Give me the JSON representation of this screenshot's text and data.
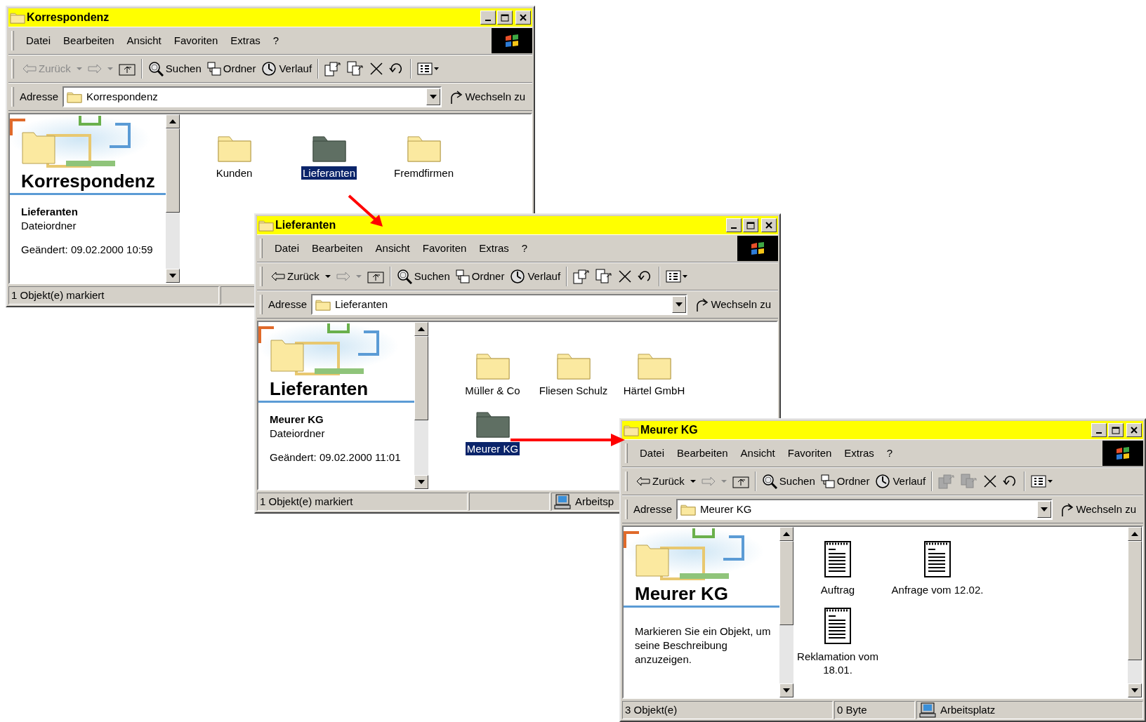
{
  "windows": [
    {
      "title": "Korrespondenz",
      "menu": [
        "Datei",
        "Bearbeiten",
        "Ansicht",
        "Favoriten",
        "Extras",
        "?"
      ],
      "toolbar": {
        "back": {
          "label": "Zurück",
          "disabled": true
        },
        "forward_disabled": true,
        "search": "Suchen",
        "folders": "Ordner",
        "history": "Verlauf",
        "move_copy_disabled": false
      },
      "address": {
        "label": "Adresse",
        "value": "Korrespondenz",
        "go": "Wechseln zu"
      },
      "sidebar": {
        "heading": "Korrespondenz",
        "selection": {
          "name": "Lieferanten",
          "type": "Dateiordner",
          "modified": "Geändert: 09.02.2000 10:59"
        }
      },
      "items": [
        {
          "label": "Kunden",
          "kind": "folder",
          "selected": false
        },
        {
          "label": "Lieferanten",
          "kind": "folder",
          "selected": true
        },
        {
          "label": "Fremdfirmen",
          "kind": "folder",
          "selected": false
        }
      ],
      "status": [
        {
          "kind": "text",
          "text": "1 Objekt(e) markiert"
        },
        {
          "kind": "blank"
        }
      ]
    },
    {
      "title": "Lieferanten",
      "menu": [
        "Datei",
        "Bearbeiten",
        "Ansicht",
        "Favoriten",
        "Extras",
        "?"
      ],
      "toolbar": {
        "back": {
          "label": "Zurück",
          "disabled": false
        },
        "forward_disabled": true,
        "search": "Suchen",
        "folders": "Ordner",
        "history": "Verlauf",
        "move_copy_disabled": false
      },
      "address": {
        "label": "Adresse",
        "value": "Lieferanten",
        "go": "Wechseln zu"
      },
      "sidebar": {
        "heading": "Lieferanten",
        "selection": {
          "name": "Meurer KG",
          "type": "Dateiordner",
          "modified": "Geändert: 09.02.2000 11:01"
        }
      },
      "items": [
        {
          "label": "Müller & Co",
          "kind": "folder",
          "selected": false
        },
        {
          "label": "Fliesen Schulz",
          "kind": "folder",
          "selected": false
        },
        {
          "label": "Härtel GmbH",
          "kind": "folder",
          "selected": false
        },
        {
          "label": "Meurer KG",
          "kind": "folder",
          "selected": true
        }
      ],
      "status": [
        {
          "kind": "text",
          "text": "1 Objekt(e) markiert"
        },
        {
          "kind": "blank"
        },
        {
          "kind": "zone",
          "text": "Arbeitsp"
        }
      ]
    },
    {
      "title": "Meurer KG",
      "menu": [
        "Datei",
        "Bearbeiten",
        "Ansicht",
        "Favoriten",
        "Extras",
        "?"
      ],
      "toolbar": {
        "back": {
          "label": "Zurück",
          "disabled": false
        },
        "forward_disabled": true,
        "search": "Suchen",
        "folders": "Ordner",
        "history": "Verlauf",
        "move_copy_disabled": true
      },
      "address": {
        "label": "Adresse",
        "value": "Meurer KG",
        "go": "Wechseln zu"
      },
      "sidebar": {
        "heading": "Meurer KG",
        "hint": "Markieren Sie ein Objekt, um seine Beschreibung anzuzeigen."
      },
      "items": [
        {
          "label": "Auftrag",
          "kind": "document",
          "selected": false
        },
        {
          "label": "Anfrage vom 12.02.",
          "kind": "document",
          "selected": false
        },
        {
          "label": "Reklamation vom 18.01.",
          "kind": "document",
          "selected": false
        }
      ],
      "status": [
        {
          "kind": "text",
          "text": "3 Objekt(e)"
        },
        {
          "kind": "text",
          "text": "0 Byte"
        },
        {
          "kind": "zone",
          "text": "Arbeitsplatz"
        }
      ]
    }
  ]
}
